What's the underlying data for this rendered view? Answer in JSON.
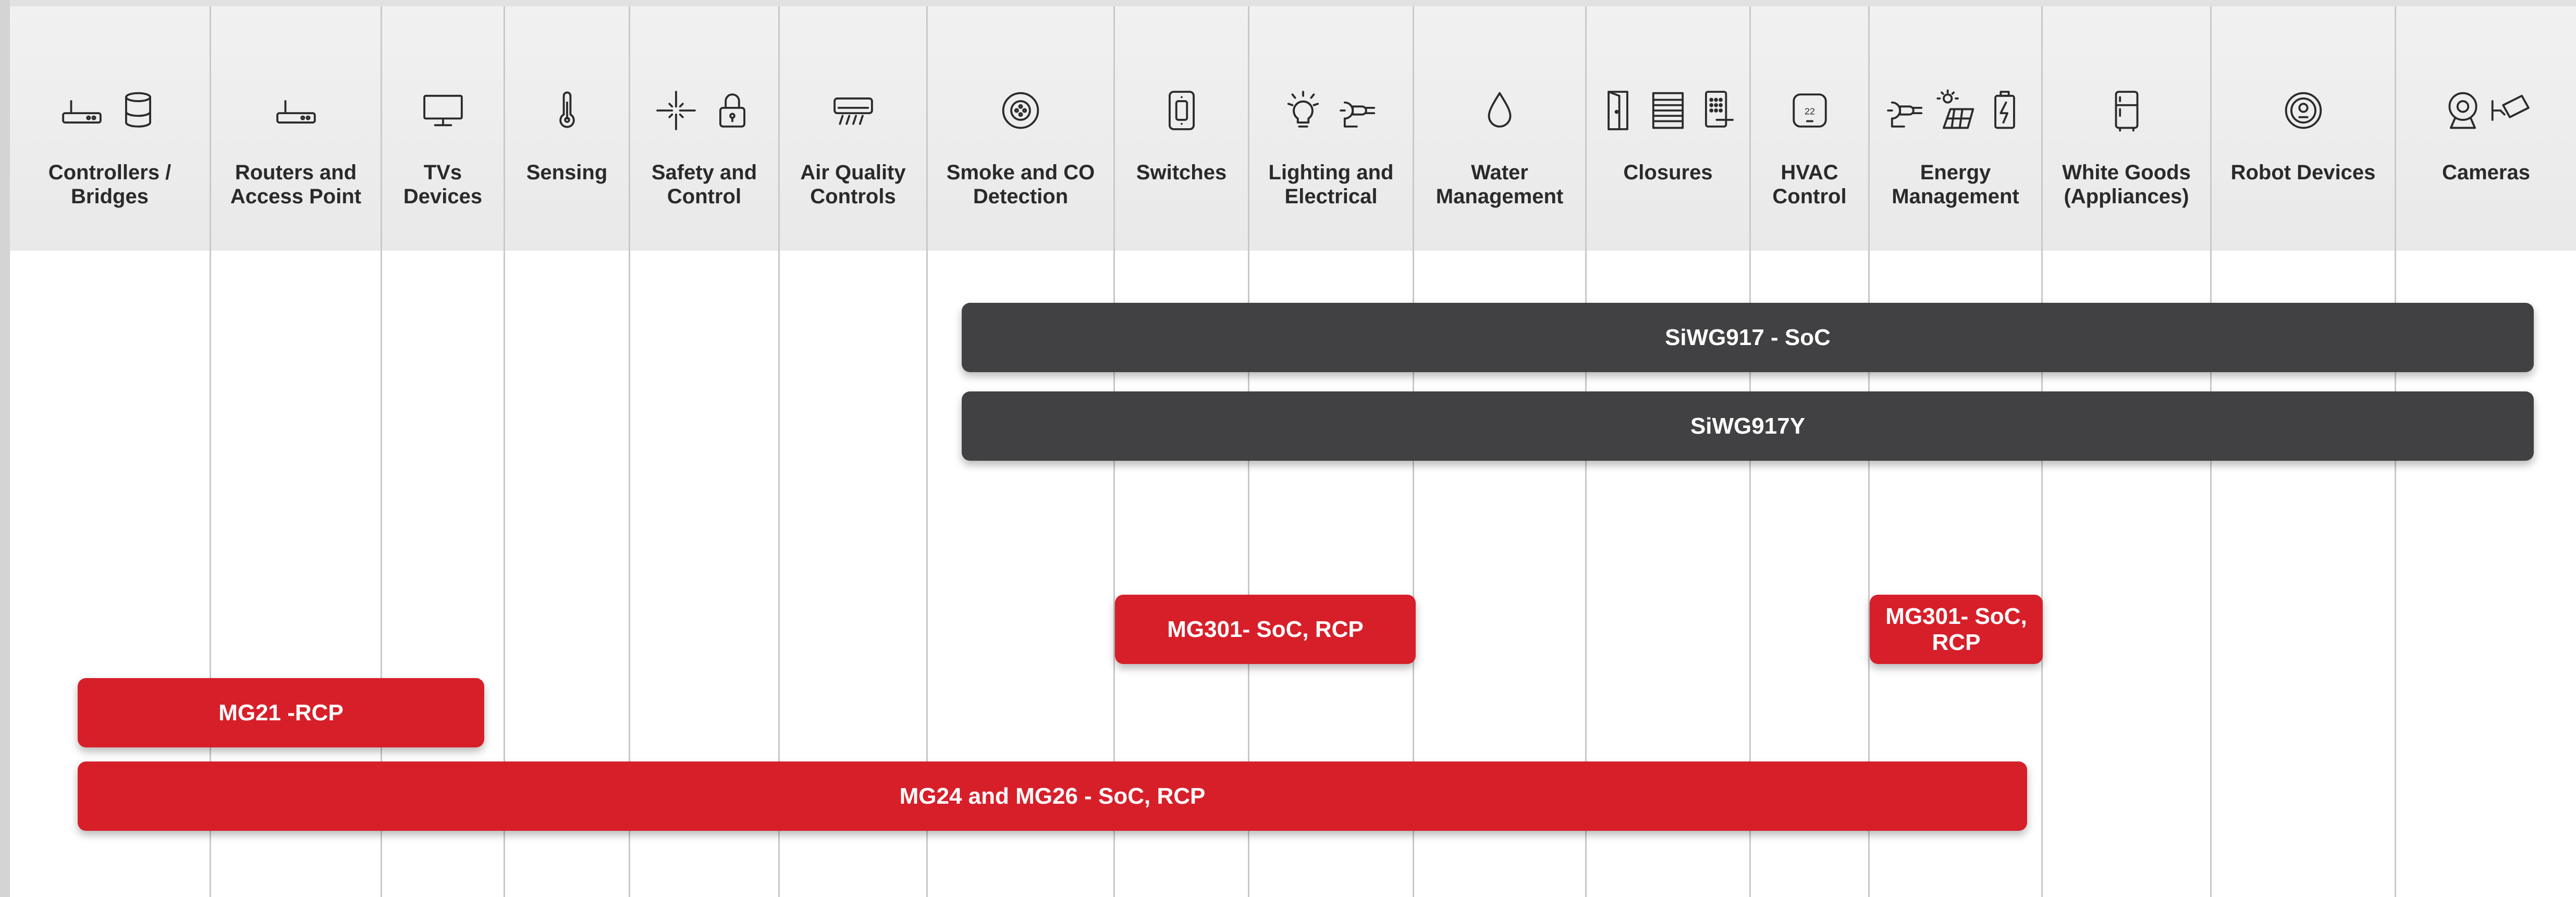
{
  "columns": [
    {
      "label": "Controllers /\nBridges",
      "icons": [
        "router-icon",
        "smart-speaker-icon"
      ]
    },
    {
      "label": "Routers and\nAccess Point",
      "icons": [
        "router-icon"
      ]
    },
    {
      "label": "TVs\nDevices",
      "icons": [
        "tv-icon"
      ]
    },
    {
      "label": "Sensing",
      "icons": [
        "thermometer-icon"
      ]
    },
    {
      "label": "Safety and\nControl",
      "icons": [
        "motion-sensor-icon",
        "lock-icon"
      ]
    },
    {
      "label": "Air Quality\nControls",
      "icons": [
        "air-conditioner-icon"
      ]
    },
    {
      "label": "Smoke and CO\nDetection",
      "icons": [
        "smoke-detector-icon"
      ]
    },
    {
      "label": "Switches",
      "icons": [
        "wall-switch-icon"
      ]
    },
    {
      "label": "Lighting and\nElectrical",
      "icons": [
        "light-bulb-icon",
        "plug-icon"
      ]
    },
    {
      "label": "Water\nManagement",
      "icons": [
        "water-drop-icon"
      ]
    },
    {
      "label": "Closures",
      "icons": [
        "door-icon",
        "blinds-icon",
        "keypad-lock-icon"
      ]
    },
    {
      "label": "HVAC\nControl",
      "icons": [
        "thermostat-icon"
      ]
    },
    {
      "label": "Energy\nManagement",
      "icons": [
        "plug-icon",
        "solar-panel-icon",
        "battery-icon"
      ]
    },
    {
      "label": "White Goods\n(Appliances)",
      "icons": [
        "refrigerator-icon"
      ]
    },
    {
      "label": "Robot Devices",
      "icons": [
        "robot-vacuum-icon"
      ]
    },
    {
      "label": "Cameras",
      "icons": [
        "webcam-icon",
        "security-camera-icon"
      ]
    }
  ],
  "thermostat_readout": "22",
  "bars": [
    {
      "label": "SiWG917 - SoC",
      "color": "#414143"
    },
    {
      "label": "SiWG917Y",
      "color": "#414143"
    },
    {
      "label": "MG301- SoC, RCP",
      "color": "#d71f2a"
    },
    {
      "label": "MG301- SoC,\nRCP",
      "color": "#d71f2a"
    },
    {
      "label": "MG21 -RCP",
      "color": "#d71f2a"
    },
    {
      "label": "MG24 and MG26 - SoC, RCP",
      "color": "#d71f2a"
    }
  ]
}
